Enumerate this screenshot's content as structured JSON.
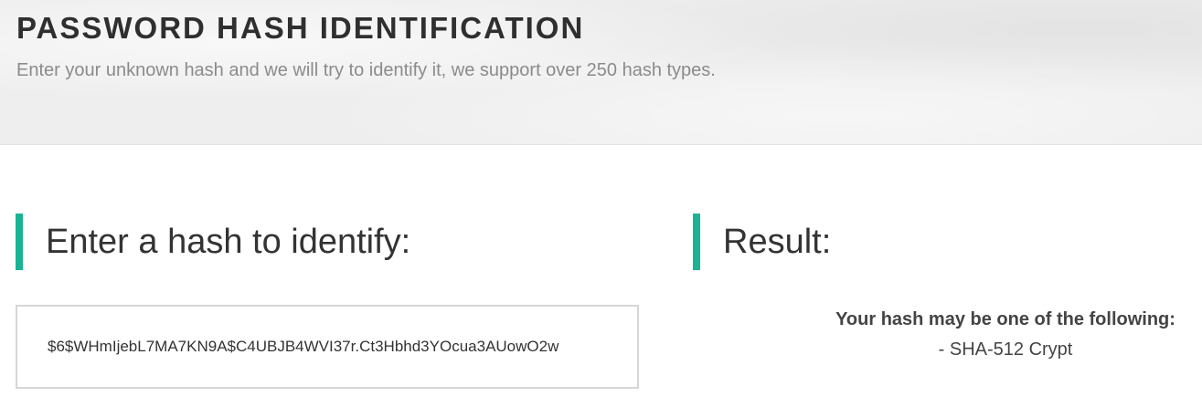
{
  "header": {
    "title": "PASSWORD HASH IDENTIFICATION",
    "subtitle": "Enter your unknown hash and we will try to identify it, we support over 250 hash types."
  },
  "input_section": {
    "heading": "Enter a hash to identify:",
    "hash_value": "$6$WHmIjebL7MA7KN9A$C4UBJB4WVI37r.Ct3Hbhd3YOcua3AUowO2w"
  },
  "result_section": {
    "heading": "Result:",
    "intro": "Your hash may be one of the following:",
    "results": [
      "- SHA-512 Crypt"
    ]
  },
  "colors": {
    "accent": "#1ab394",
    "hero_background": "#eeeeee",
    "subtitle_text": "#8b8b8b"
  }
}
